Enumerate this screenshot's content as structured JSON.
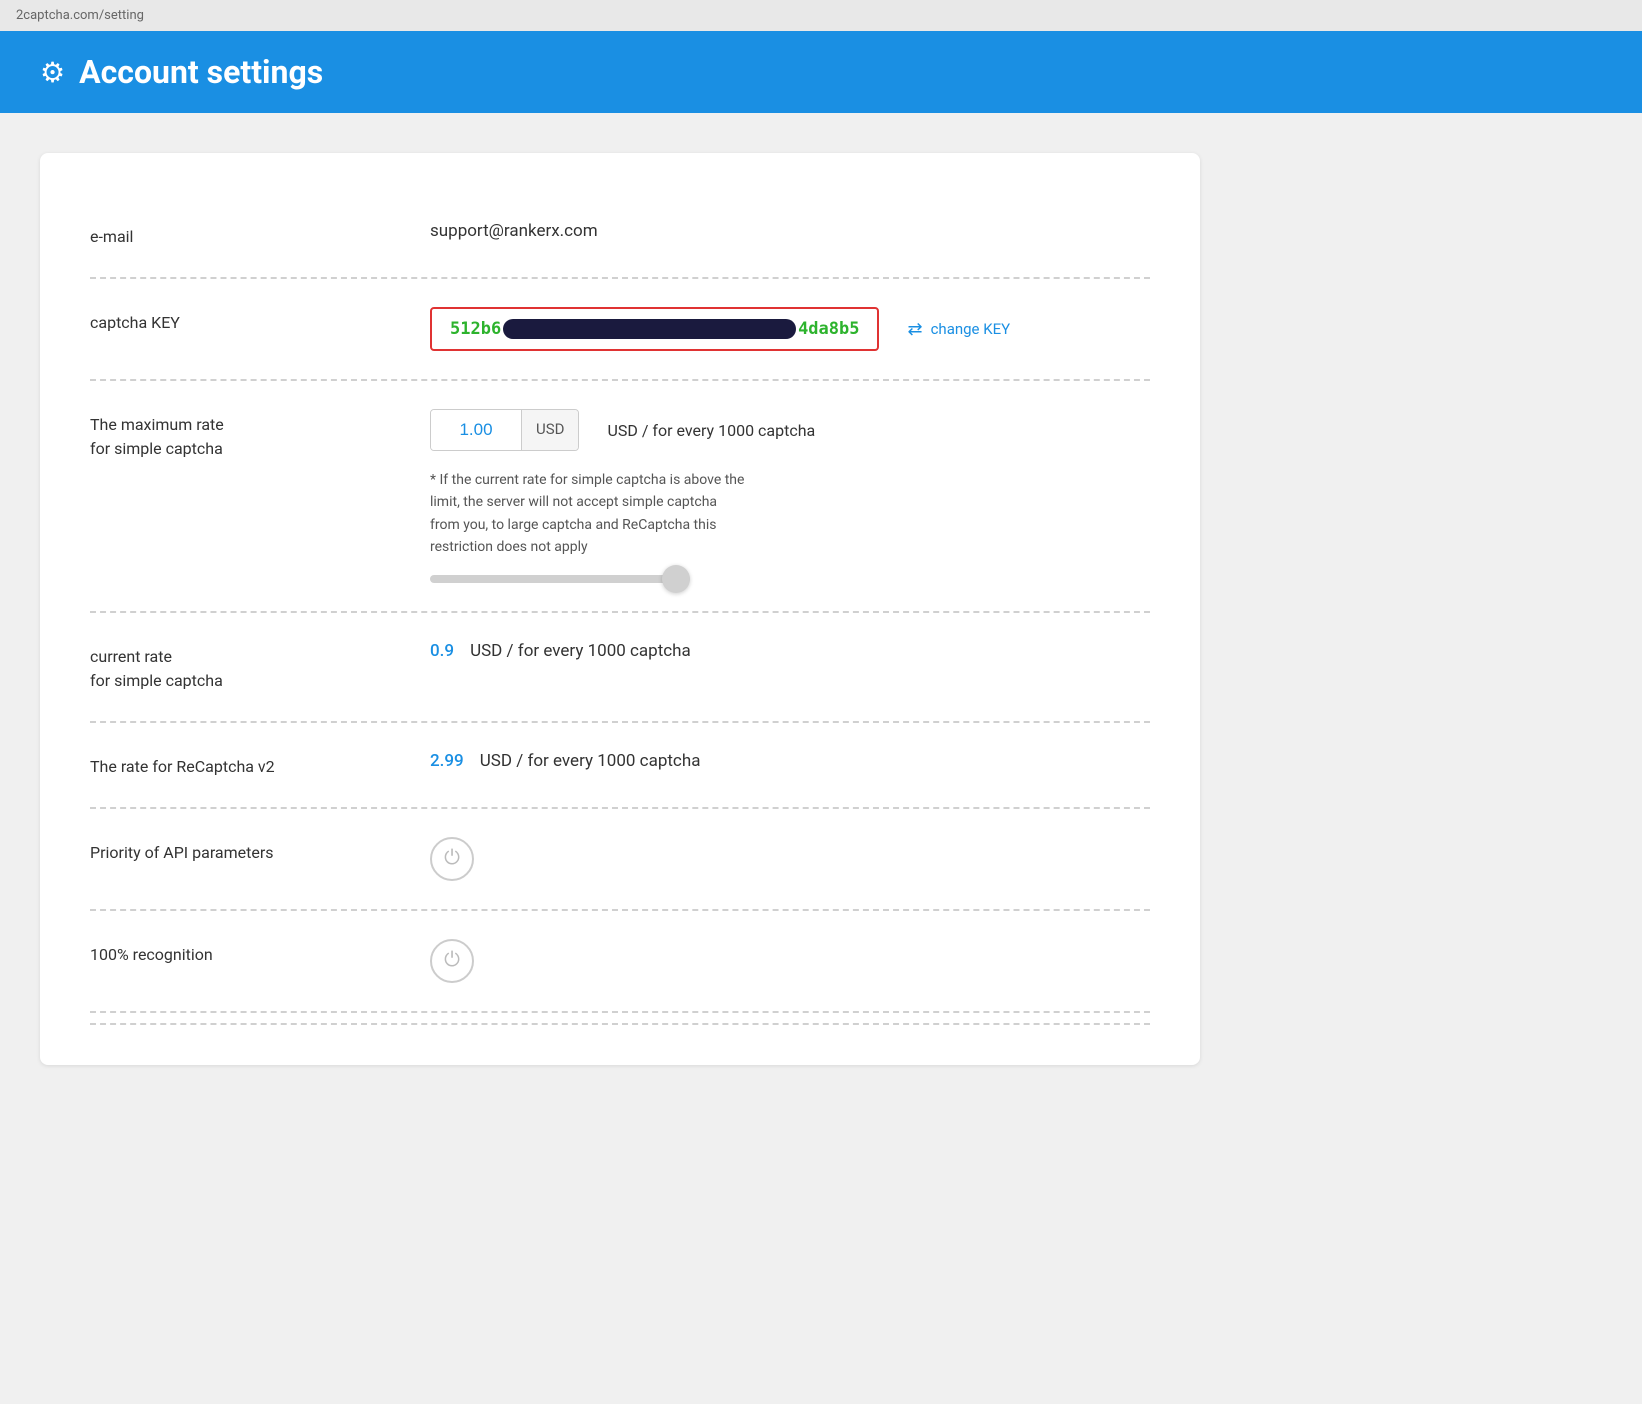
{
  "browser": {
    "url": "2captcha.com/setting"
  },
  "header": {
    "icon": "⚙",
    "title": "Account settings"
  },
  "settings": {
    "email": {
      "label": "e-mail",
      "value": "support@rankerx.com"
    },
    "captcha_key": {
      "label": "captcha KEY",
      "key_start": "512b6",
      "key_masked": "●●●●●●●●●●●●●●●●●●●●",
      "key_end": "4da8b5",
      "change_label": "change KEY"
    },
    "max_rate": {
      "label_line1": "The maximum rate",
      "label_line2": "for simple captcha",
      "value": "1.00",
      "currency": "USD",
      "description": "USD / for every 1000 captcha",
      "note": "* If the current rate for simple captcha is above the limit, the server will not accept simple captcha from you, to large captcha and ReCaptcha this restriction does not apply"
    },
    "current_rate": {
      "label_line1": "current rate",
      "label_line2": "for simple captcha",
      "value": "0.9",
      "description": "USD / for every 1000 captcha"
    },
    "recaptcha_rate": {
      "label": "The rate for ReCaptcha v2",
      "value": "2.99",
      "description": "USD / for every 1000 captcha"
    },
    "api_priority": {
      "label": "Priority of API parameters"
    },
    "recognition": {
      "label": "100% recognition"
    }
  }
}
